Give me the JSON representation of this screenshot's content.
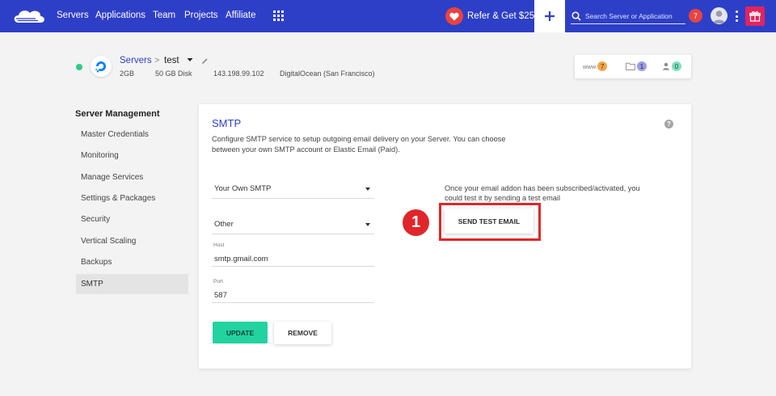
{
  "colors": {
    "nav_bg": "#2e3fc7",
    "accent": "#2e3fc7",
    "badge_red": "#e8433f",
    "success": "#22d3a0",
    "gift": "#e0245e",
    "annotation_red": "#e0262a"
  },
  "topnav": {
    "items": [
      {
        "label": "Servers"
      },
      {
        "label": "Applications"
      },
      {
        "label": "Team"
      },
      {
        "label": "Projects"
      },
      {
        "label": "Affiliate"
      }
    ],
    "refer_label": "Refer & Get $25",
    "search_placeholder": "Search Server or Application",
    "notification_count": "7",
    "icons": [
      "cloudways-logo",
      "apps-grid-icon",
      "heart-icon",
      "plus-icon",
      "search-icon",
      "avatar",
      "more-vertical-icon",
      "gift-icon"
    ]
  },
  "server": {
    "breadcrumb_root": "Servers",
    "breadcrumb_sep": ">",
    "name": "test",
    "ram": "2GB",
    "disk": "50 GB Disk",
    "ip": "143.198.99.102",
    "provider": "DigitalOcean (San Francisco)",
    "status": "running"
  },
  "stats": {
    "www_label": "www",
    "apps_count": "7",
    "projects_count": "1",
    "team_count": "0"
  },
  "sidebar": {
    "title": "Server Management",
    "items": [
      {
        "label": "Master Credentials"
      },
      {
        "label": "Monitoring"
      },
      {
        "label": "Manage Services"
      },
      {
        "label": "Settings & Packages"
      },
      {
        "label": "Security"
      },
      {
        "label": "Vertical Scaling"
      },
      {
        "label": "Backups"
      },
      {
        "label": "SMTP",
        "active": true
      }
    ]
  },
  "smtp": {
    "title": "SMTP",
    "help": "?",
    "description": "Configure SMTP service to setup outgoing email delivery on your Server. You can choose between your own SMTP account or Elastic Email (Paid).",
    "mode_select": "Your Own SMTP",
    "provider_select": "Other",
    "host_label": "Host",
    "host_value": "smtp.gmail.com",
    "port_label": "Port",
    "port_value": "587",
    "update_label": "UPDATE",
    "remove_label": "REMOVE",
    "test_note": "Once your email addon has been subscribed/activated, you could test it by sending a test email",
    "test_button": "SEND TEST EMAIL"
  },
  "annotation": {
    "step_number": "1"
  }
}
